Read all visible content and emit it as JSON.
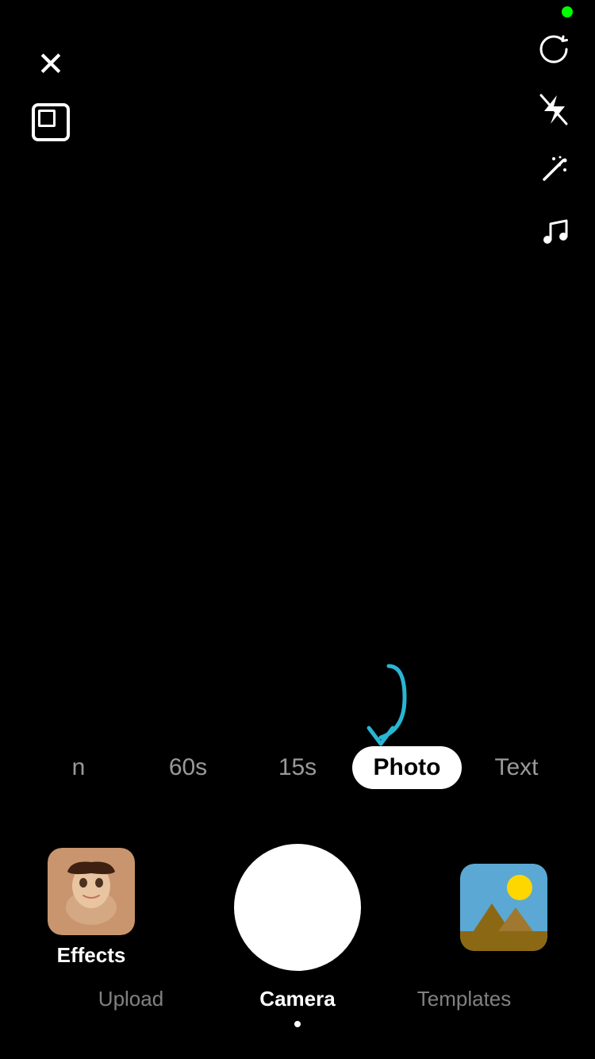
{
  "status": {
    "dot_color": "#00d100"
  },
  "top_left": {
    "close_label": "×",
    "frame_label": "⬛"
  },
  "top_right": {
    "rotate_icon": "↻",
    "flash_icon": "⚡",
    "magic_icon": "✨",
    "music_icon": "♪"
  },
  "mode_bar": {
    "items": [
      {
        "id": "n",
        "label": "n",
        "active": false
      },
      {
        "id": "60s",
        "label": "60s",
        "active": false
      },
      {
        "id": "15s",
        "label": "15s",
        "active": false
      },
      {
        "id": "photo",
        "label": "Photo",
        "active": true
      },
      {
        "id": "text",
        "label": "Text",
        "active": false
      }
    ]
  },
  "bottom_nav": {
    "items": [
      {
        "id": "upload",
        "label": "Upload",
        "active": false
      },
      {
        "id": "camera",
        "label": "Camera",
        "active": true
      },
      {
        "id": "templates",
        "label": "Templates",
        "active": false
      }
    ]
  },
  "effects_label": "Effects",
  "camera_label": "Camera",
  "templates_label": "Templates",
  "upload_label": "Upload"
}
